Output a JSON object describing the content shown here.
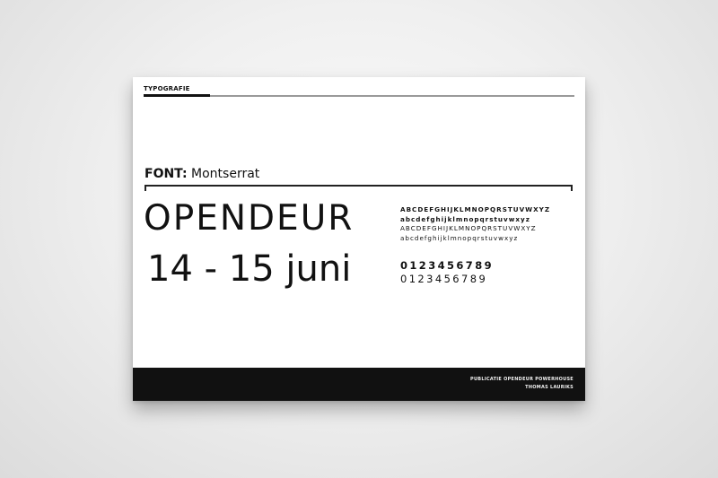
{
  "header": {
    "section_label": "TYPOGRAFIE"
  },
  "font_spec": {
    "key": "FONT:",
    "value": "Montserrat"
  },
  "sample": {
    "title": "OPENDEUR",
    "date": "14 - 15 juni"
  },
  "alphabet": {
    "upper_bold": "ABCDEFGHIJKLMNOPQRSTUVWXYZ",
    "lower_bold": "abcdefghijklmnopqrstuvwxyz",
    "upper_regular": "ABCDEFGHIJKLMNOPQRSTUVWXYZ",
    "lower_regular": "abcdefghijklmnopqrstuvwxyz"
  },
  "digits": {
    "bold": "0123456789",
    "regular": "0123456789"
  },
  "footer": {
    "line1": "PUBLICATIE OPENDEUR POWERHOUSE",
    "line2": "THOMAS LAURIKS"
  },
  "colors": {
    "ink": "#111111",
    "paper": "#ffffff",
    "rule_gray": "#9a9a9a",
    "background": "#e6e6e6"
  }
}
